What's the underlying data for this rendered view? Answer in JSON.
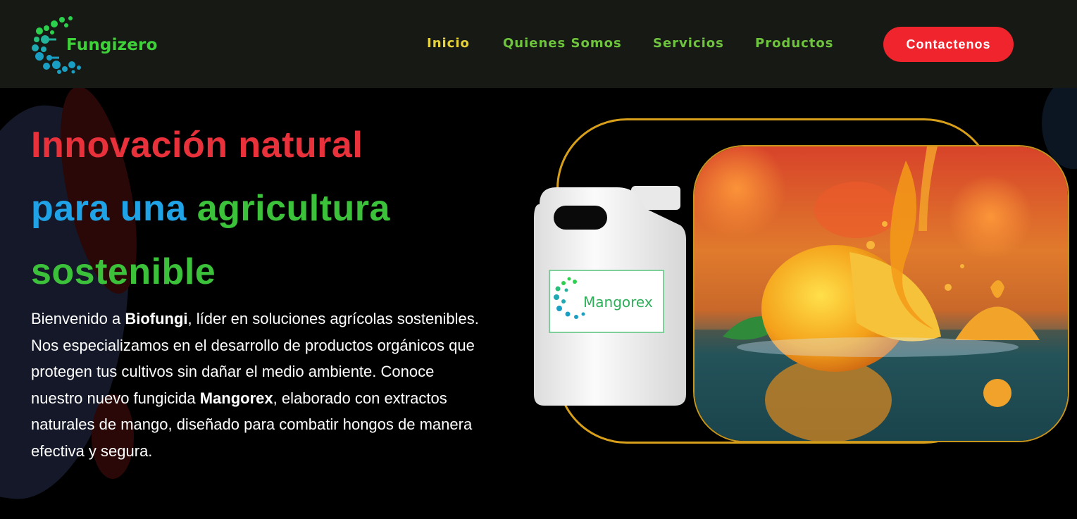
{
  "brand": {
    "name": "Fungizero"
  },
  "nav": {
    "items": [
      "Inicio",
      "Quienes Somos",
      "Servicios",
      "Productos"
    ],
    "active": "Inicio",
    "contact_label": "Contactenos"
  },
  "hero": {
    "title_line1": "Innovación natural",
    "title_line2_a": "para",
    "title_line2_b": "una",
    "title_line2_c": "agricultura",
    "title_line3": "sostenible",
    "para": {
      "p1": "Bienvenido a ",
      "brand": "Biofungi",
      "p2": ", líder en soluciones agrícolas sostenibles. Nos especializamos en el desarrollo de productos orgánicos que protegen tus cultivos sin dañar el medio ambiente. Conoce nuestro nuevo fungicida ",
      "product": "Mangorex",
      "p3": ", elaborado con extractos naturales de mango, diseñado para combatir hongos de manera efectiva y segura."
    }
  },
  "product": {
    "label": "Mangorex"
  },
  "colors": {
    "header_bg": "#171a14",
    "active_nav": "#e8d23a",
    "nav": "#6fc43e",
    "cta": "#f0242c",
    "title_red": "#e8313b",
    "title_blue": "#1fa3e6",
    "title_green": "#3cc13a",
    "frame_gold": "#d8a01a"
  }
}
